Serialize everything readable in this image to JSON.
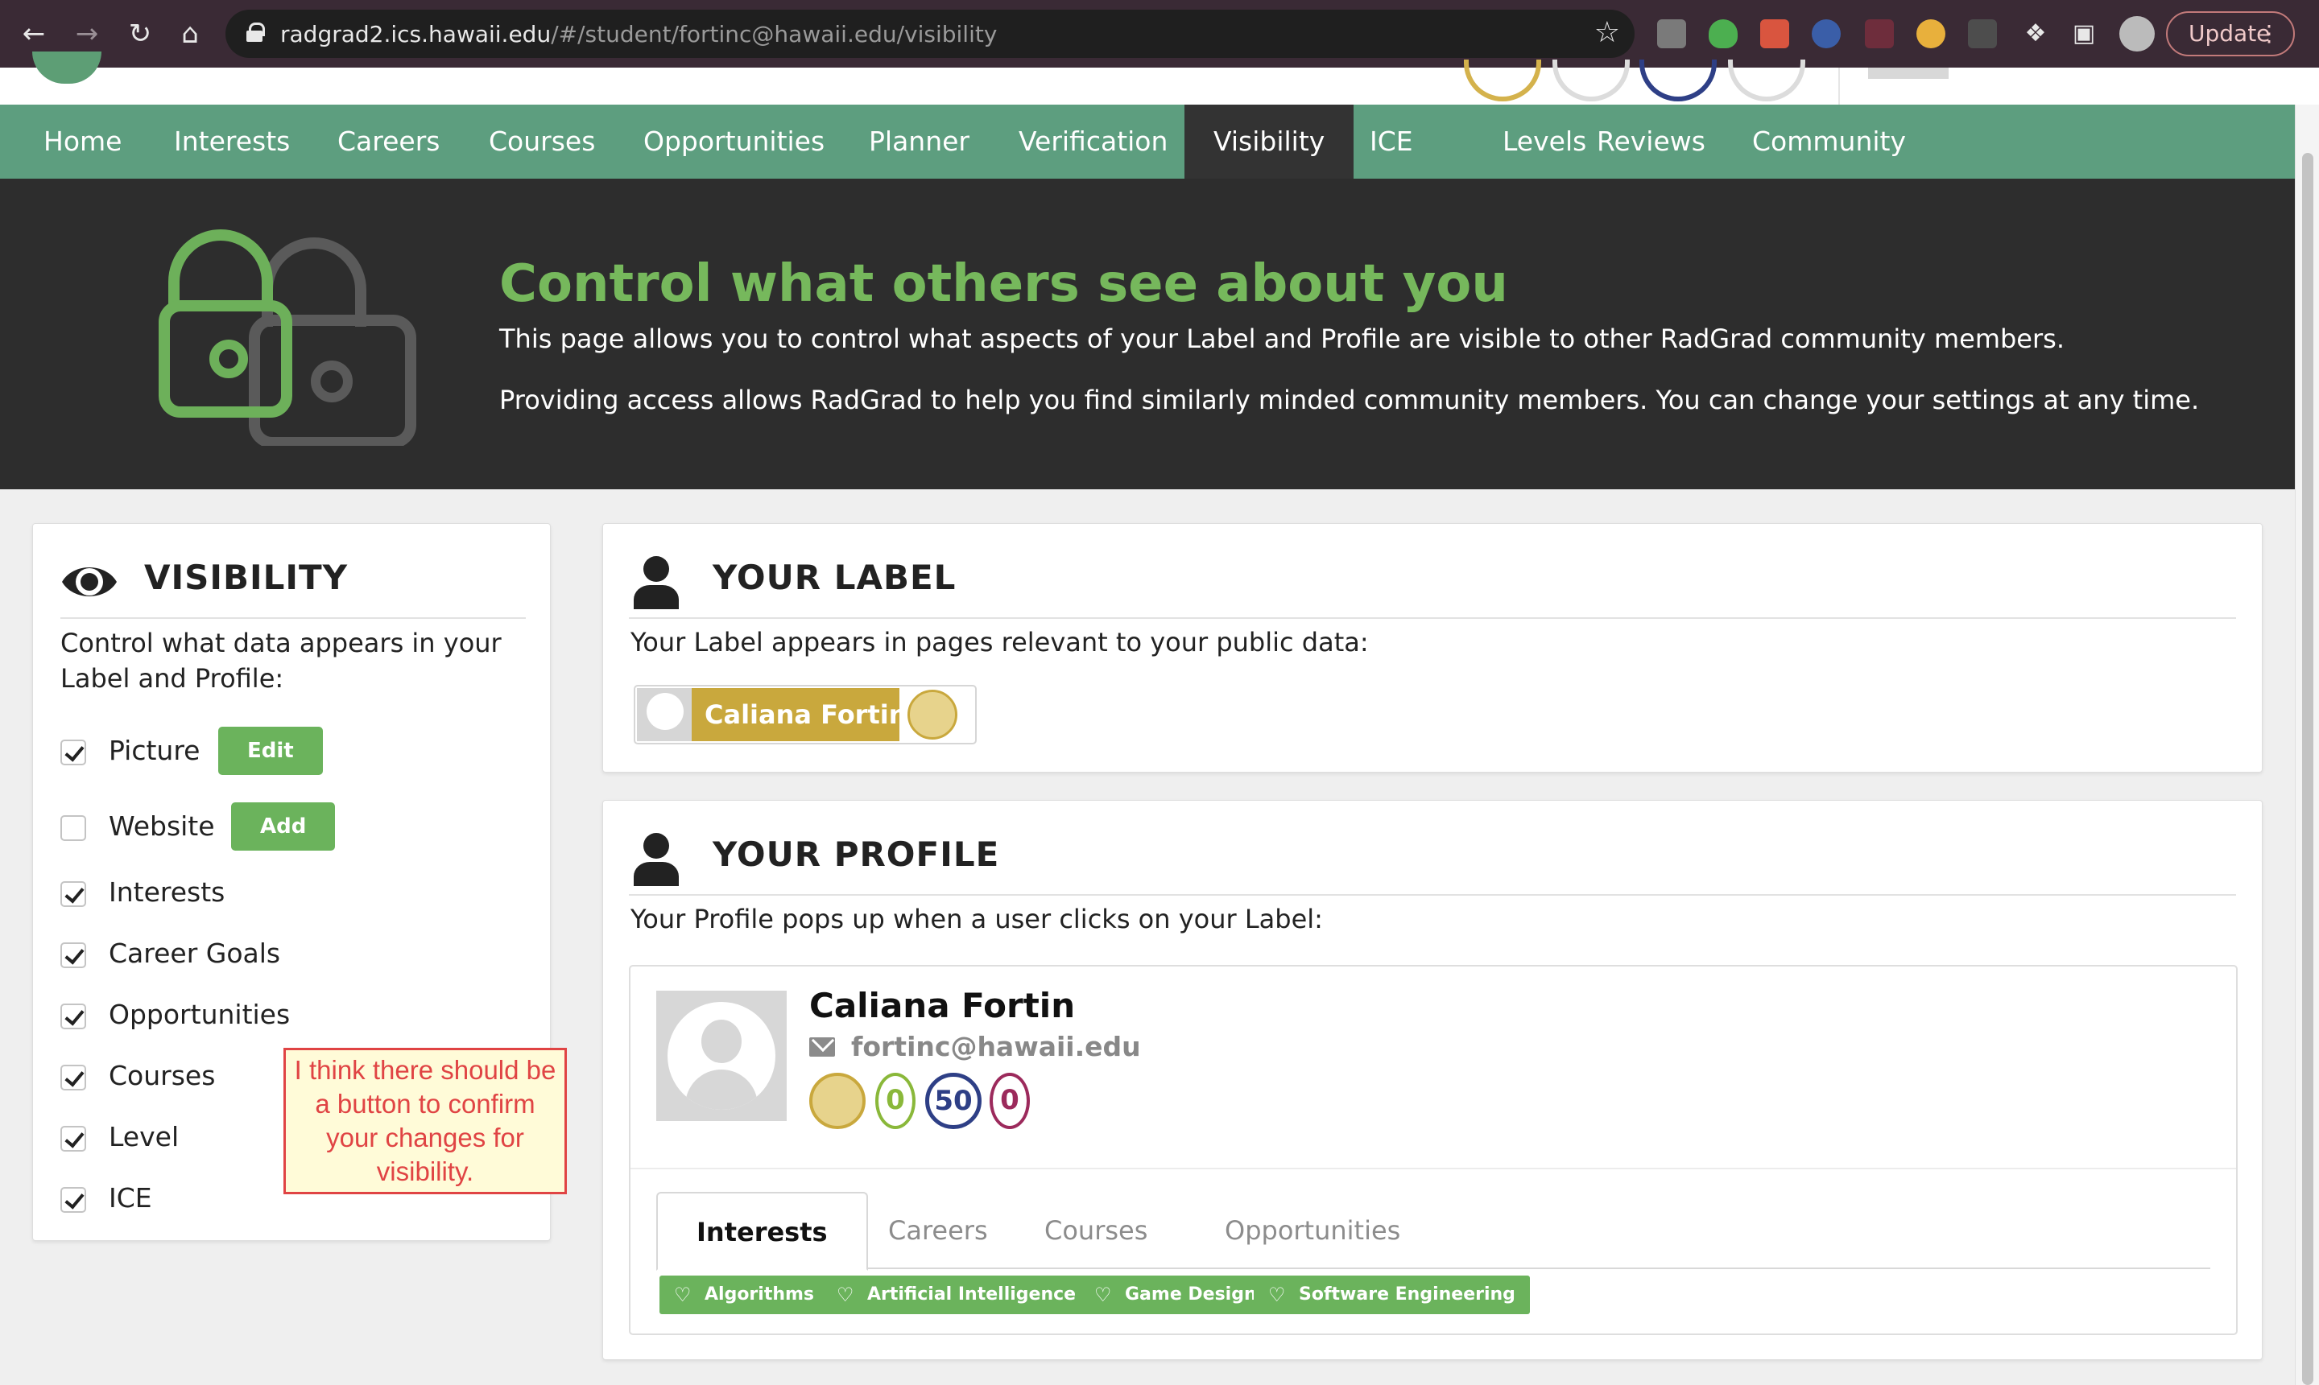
{
  "browser": {
    "url_host": "radgrad2.ics.hawaii.edu",
    "url_path": "/#/student/fortinc@hawaii.edu/visibility",
    "update_label": "Update",
    "icons": [
      "back-icon",
      "forward-icon",
      "reload-icon",
      "home-icon",
      "lock-icon",
      "star-icon",
      "extensions-icon",
      "cast-icon",
      "profile-avatar-icon",
      "more-icon"
    ]
  },
  "nav": {
    "items": [
      {
        "label": "Home"
      },
      {
        "label": "Interests"
      },
      {
        "label": "Careers"
      },
      {
        "label": "Courses"
      },
      {
        "label": "Opportunities"
      },
      {
        "label": "Planner"
      },
      {
        "label": "Verification"
      },
      {
        "label": "Visibility",
        "active": true
      },
      {
        "label": "ICE"
      },
      {
        "label": "Levels"
      },
      {
        "label": "Reviews"
      },
      {
        "label": "Community"
      }
    ]
  },
  "hero": {
    "title": "Control what others see about you",
    "line1": "This page allows you to control what aspects of your Label and Profile are visible to other RadGrad community members.",
    "line2": "Providing access allows RadGrad to help you find similarly minded community members. You can change your settings at any time."
  },
  "visibility": {
    "title": "VISIBILITY",
    "description": "Control what data appears in your Label and Profile:",
    "options": [
      {
        "label": "Picture",
        "checked": true,
        "button": "Edit"
      },
      {
        "label": "Website",
        "checked": false,
        "button": "Add"
      },
      {
        "label": "Interests",
        "checked": true
      },
      {
        "label": "Career Goals",
        "checked": true
      },
      {
        "label": "Opportunities",
        "checked": true
      },
      {
        "label": "Courses",
        "checked": true
      },
      {
        "label": "Level",
        "checked": true
      },
      {
        "label": "ICE",
        "checked": true
      }
    ]
  },
  "note": {
    "text": "I think there should be a button to confirm your changes for visibility."
  },
  "label_section": {
    "title": "YOUR LABEL",
    "description": "Your Label appears in pages relevant to your public data:",
    "name": "Caliana Fortin"
  },
  "profile_section": {
    "title": "YOUR PROFILE",
    "description": "Your Profile pops up when a user clicks on your Label:",
    "name": "Caliana Fortin",
    "email": "fortinc@hawaii.edu",
    "ice": {
      "innovation": "0",
      "competency": "50",
      "experience": "0"
    },
    "tabs": [
      {
        "label": "Interests",
        "active": true
      },
      {
        "label": "Careers"
      },
      {
        "label": "Courses"
      },
      {
        "label": "Opportunities"
      }
    ],
    "interests": [
      "Algorithms",
      "Artificial Intelligence",
      "Game Design",
      "Software Engineering"
    ]
  },
  "colors": {
    "nav_green": "#5d9e7f",
    "accent_green": "#6bb35c",
    "title_green": "#76b85c",
    "gold": "#c9a83d",
    "ice_innovation": "#8ab83a",
    "ice_competency": "#2e3f86",
    "ice_experience": "#9c2a5c",
    "note_red": "#e04444"
  }
}
